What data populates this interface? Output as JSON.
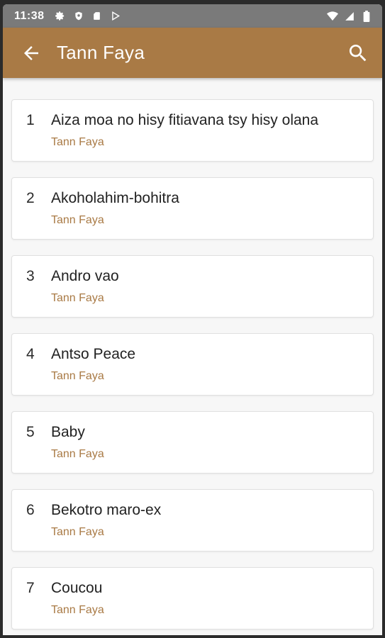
{
  "status_bar": {
    "time": "11:38",
    "icons_left": [
      "gear-icon",
      "shield-icon",
      "sdcard-icon",
      "play-store-icon"
    ],
    "icons_right": [
      "wifi-icon",
      "signal-icon",
      "battery-icon"
    ]
  },
  "app_bar": {
    "title": "Tann Faya",
    "back_icon": "arrow-left-icon",
    "search_icon": "search-icon",
    "color": "#a97a45"
  },
  "songs": [
    {
      "number": "1",
      "title": "Aiza moa no hisy fitiavana tsy hisy olana",
      "artist": "Tann Faya"
    },
    {
      "number": "2",
      "title": "Akoholahim-bohitra",
      "artist": "Tann Faya"
    },
    {
      "number": "3",
      "title": "Andro vao",
      "artist": "Tann Faya"
    },
    {
      "number": "4",
      "title": "Antso Peace",
      "artist": "Tann Faya"
    },
    {
      "number": "5",
      "title": "Baby",
      "artist": "Tann Faya"
    },
    {
      "number": "6",
      "title": "Bekotro maro-ex",
      "artist": "Tann Faya"
    },
    {
      "number": "7",
      "title": "Coucou",
      "artist": "Tann Faya"
    }
  ]
}
